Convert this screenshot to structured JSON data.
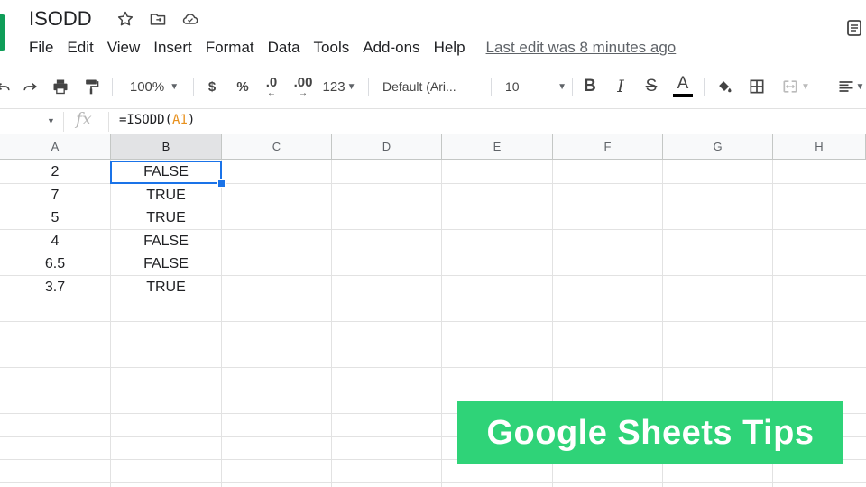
{
  "document": {
    "title": "ISODD"
  },
  "menu": {
    "items": [
      "File",
      "Edit",
      "View",
      "Insert",
      "Format",
      "Data",
      "Tools",
      "Add-ons",
      "Help"
    ],
    "last_edit": "Last edit was 8 minutes ago"
  },
  "toolbar": {
    "zoom": "100%",
    "currency": "$",
    "percent": "%",
    "decrease_decimals": ".0",
    "increase_decimals": ".00",
    "more_formats": "123",
    "font": "Default (Ari...",
    "font_size": "10",
    "bold": "B",
    "italic": "I",
    "strike": "S",
    "text_color": "A"
  },
  "formula_bar": {
    "fx": "fx",
    "formula_prefix": "=ISODD(",
    "formula_ref": "A1",
    "formula_suffix": ")"
  },
  "grid": {
    "columns": [
      "A",
      "B",
      "C",
      "D",
      "E",
      "F",
      "G",
      "H"
    ],
    "selected_column": "B",
    "selected_cell": "B1",
    "rows": [
      {
        "a": "2",
        "b": "FALSE"
      },
      {
        "a": "7",
        "b": "TRUE"
      },
      {
        "a": "5",
        "b": "TRUE"
      },
      {
        "a": "4",
        "b": "FALSE"
      },
      {
        "a": "6.5",
        "b": "FALSE"
      },
      {
        "a": "3.7",
        "b": "TRUE"
      }
    ]
  },
  "banner": {
    "text": "Google Sheets Tips"
  },
  "colors": {
    "accent": "#1a73e8",
    "banner": "#2fd378",
    "sheets_green": "#0f9d58"
  }
}
